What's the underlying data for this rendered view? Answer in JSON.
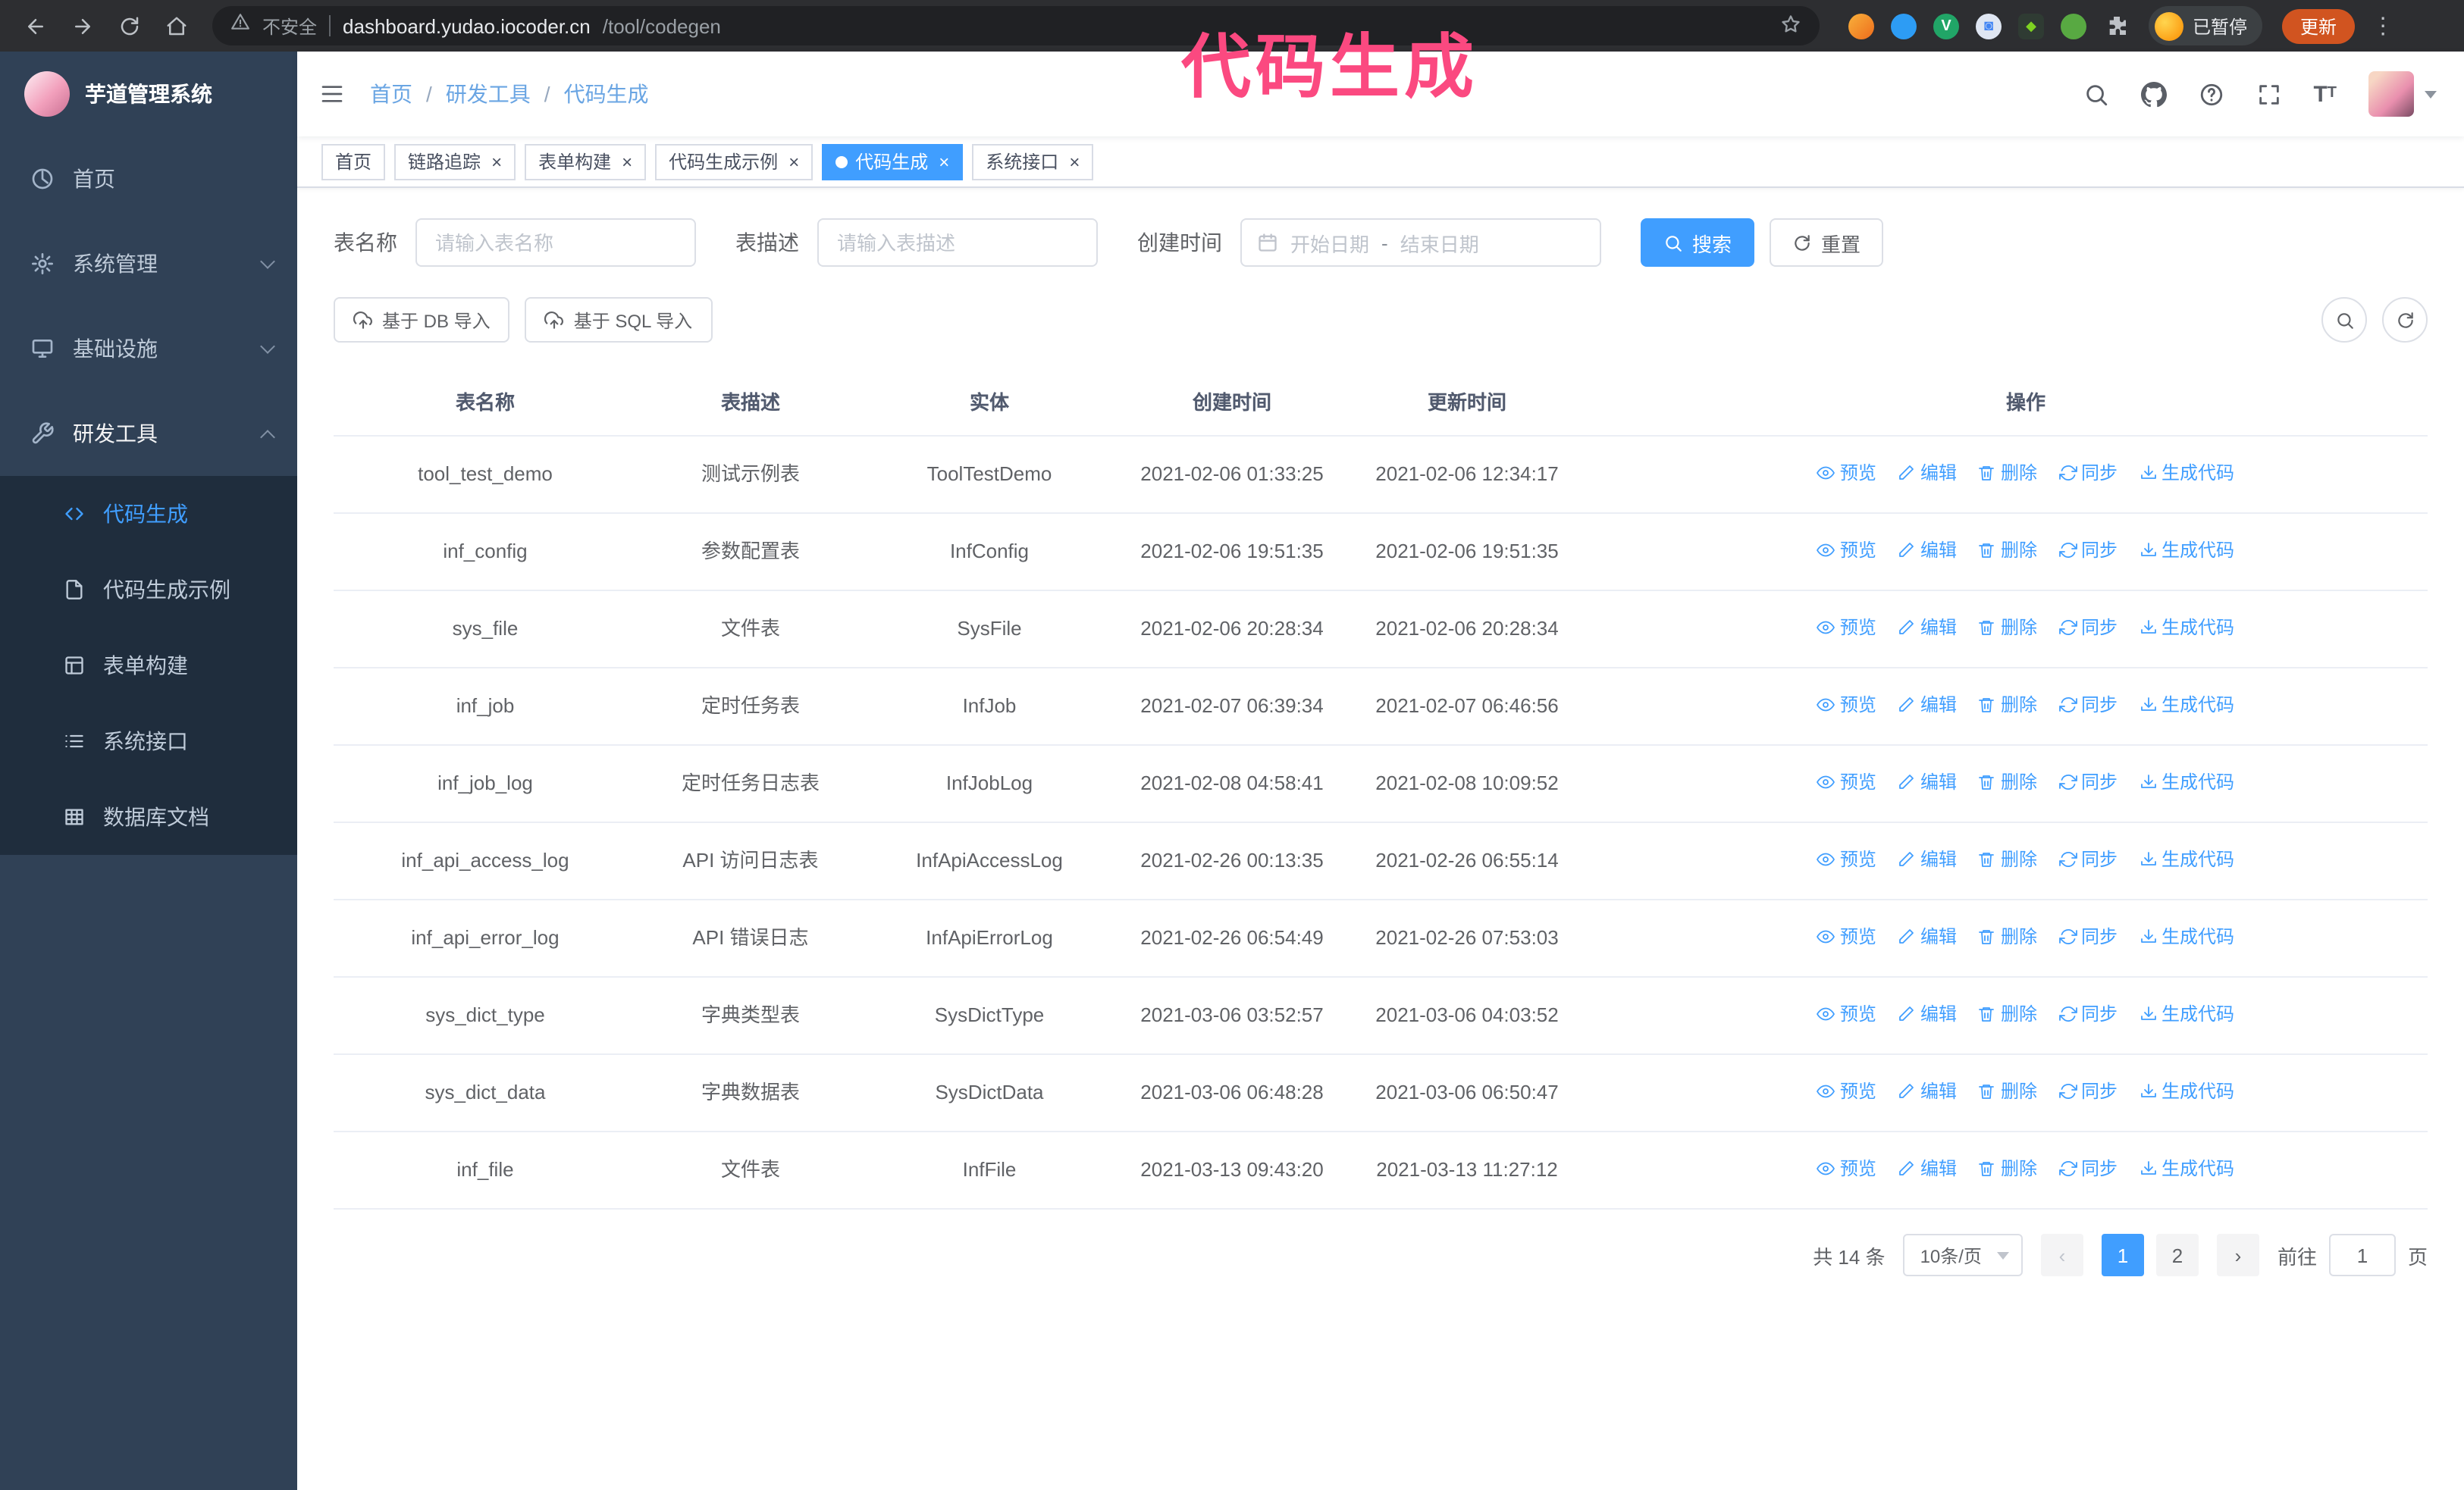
{
  "annotation": {
    "text": "代码生成"
  },
  "browser": {
    "security_label": "不安全",
    "url_host": "dashboard.yudao.iocoder.cn",
    "url_path": "/tool/codegen",
    "profile_label": "已暂停",
    "update_label": "更新"
  },
  "sidebar": {
    "logo_title": "芋道管理系统",
    "items": [
      {
        "label": "首页"
      },
      {
        "label": "系统管理"
      },
      {
        "label": "基础设施"
      },
      {
        "label": "研发工具"
      }
    ],
    "subitems": [
      {
        "label": "代码生成",
        "active": true
      },
      {
        "label": "代码生成示例"
      },
      {
        "label": "表单构建"
      },
      {
        "label": "系统接口"
      },
      {
        "label": "数据库文档"
      }
    ]
  },
  "header": {
    "separator": "/",
    "breadcrumb": [
      {
        "label": "首页"
      },
      {
        "label": "研发工具"
      },
      {
        "label": "代码生成"
      }
    ]
  },
  "tabs": [
    {
      "label": "首页",
      "closable": false,
      "active": false
    },
    {
      "label": "链路追踪",
      "closable": true,
      "active": false
    },
    {
      "label": "表单构建",
      "closable": true,
      "active": false
    },
    {
      "label": "代码生成示例",
      "closable": true,
      "active": false
    },
    {
      "label": "代码生成",
      "closable": true,
      "active": true
    },
    {
      "label": "系统接口",
      "closable": true,
      "active": false
    }
  ],
  "filters": {
    "name_label": "表名称",
    "name_placeholder": "请输入表名称",
    "desc_label": "表描述",
    "desc_placeholder": "请输入表描述",
    "time_label": "创建时间",
    "date_start": "开始日期",
    "date_sep": "-",
    "date_end": "结束日期",
    "search_label": "搜索",
    "reset_label": "重置"
  },
  "toolbar": {
    "import_db": "基于 DB 导入",
    "import_sql": "基于 SQL 导入"
  },
  "table": {
    "columns": [
      "表名称",
      "表描述",
      "实体",
      "创建时间",
      "更新时间",
      "操作"
    ],
    "actions": [
      "预览",
      "编辑",
      "删除",
      "同步",
      "生成代码"
    ],
    "rows": [
      {
        "name": "tool_test_demo",
        "desc": "测试示例表",
        "entity": "ToolTestDemo",
        "created": "2021-02-06 01:33:25",
        "updated": "2021-02-06 12:34:17"
      },
      {
        "name": "inf_config",
        "desc": "参数配置表",
        "entity": "InfConfig",
        "created": "2021-02-06 19:51:35",
        "updated": "2021-02-06 19:51:35"
      },
      {
        "name": "sys_file",
        "desc": "文件表",
        "entity": "SysFile",
        "created": "2021-02-06 20:28:34",
        "updated": "2021-02-06 20:28:34"
      },
      {
        "name": "inf_job",
        "desc": "定时任务表",
        "entity": "InfJob",
        "created": "2021-02-07 06:39:34",
        "updated": "2021-02-07 06:46:56"
      },
      {
        "name": "inf_job_log",
        "desc": "定时任务日志表",
        "entity": "InfJobLog",
        "created": "2021-02-08 04:58:41",
        "updated": "2021-02-08 10:09:52"
      },
      {
        "name": "inf_api_access_log",
        "desc": "API 访问日志表",
        "entity": "InfApiAccessLog",
        "created": "2021-02-26 00:13:35",
        "updated": "2021-02-26 06:55:14"
      },
      {
        "name": "inf_api_error_log",
        "desc": "API 错误日志",
        "entity": "InfApiErrorLog",
        "created": "2021-02-26 06:54:49",
        "updated": "2021-02-26 07:53:03"
      },
      {
        "name": "sys_dict_type",
        "desc": "字典类型表",
        "entity": "SysDictType",
        "created": "2021-03-06 03:52:57",
        "updated": "2021-03-06 04:03:52"
      },
      {
        "name": "sys_dict_data",
        "desc": "字典数据表",
        "entity": "SysDictData",
        "created": "2021-03-06 06:48:28",
        "updated": "2021-03-06 06:50:47"
      },
      {
        "name": "inf_file",
        "desc": "文件表",
        "entity": "InfFile",
        "created": "2021-03-13 09:43:20",
        "updated": "2021-03-13 11:27:12"
      }
    ]
  },
  "pagination": {
    "total": "共 14 条",
    "page_size": "10条/页",
    "pages": [
      "1",
      "2"
    ],
    "active_page": "1",
    "goto_prefix": "前往",
    "goto_value": "1",
    "goto_suffix": "页"
  },
  "colors": {
    "primary": "#409eff",
    "sidebar_bg": "#304156",
    "submenu_bg": "#1f2d3d",
    "annotation": "#fb4980"
  }
}
